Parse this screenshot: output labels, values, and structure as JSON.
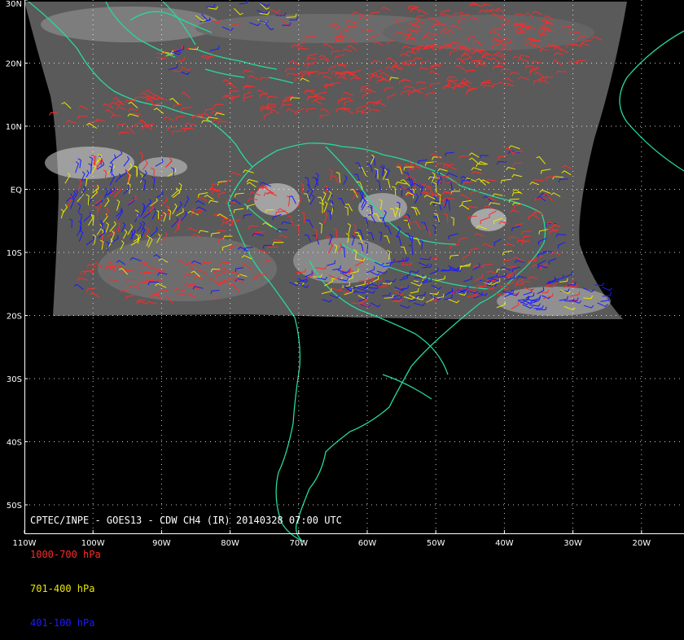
{
  "product": {
    "title": "CPTEC/INPE - GOES13 - CDW CH4 (IR) 20140328 07:00 UTC"
  },
  "legend": [
    {
      "label": "1000-700 hPa",
      "color": "#ff2a2a"
    },
    {
      "label": "701-400 hPa",
      "color": "#e8e800"
    },
    {
      "label": "401-100 hPa",
      "color": "#1a1aff"
    }
  ],
  "coastline_color": "#28d89a",
  "grid_color": "#ffffff",
  "axes": {
    "lon_labels": [
      "110W",
      "100W",
      "90W",
      "80W",
      "70W",
      "60W",
      "50W",
      "40W",
      "30W",
      "20W"
    ],
    "lat_labels": [
      "30N",
      "20N",
      "10N",
      "EQ",
      "10S",
      "20S",
      "30S",
      "40S",
      "50S"
    ]
  }
}
